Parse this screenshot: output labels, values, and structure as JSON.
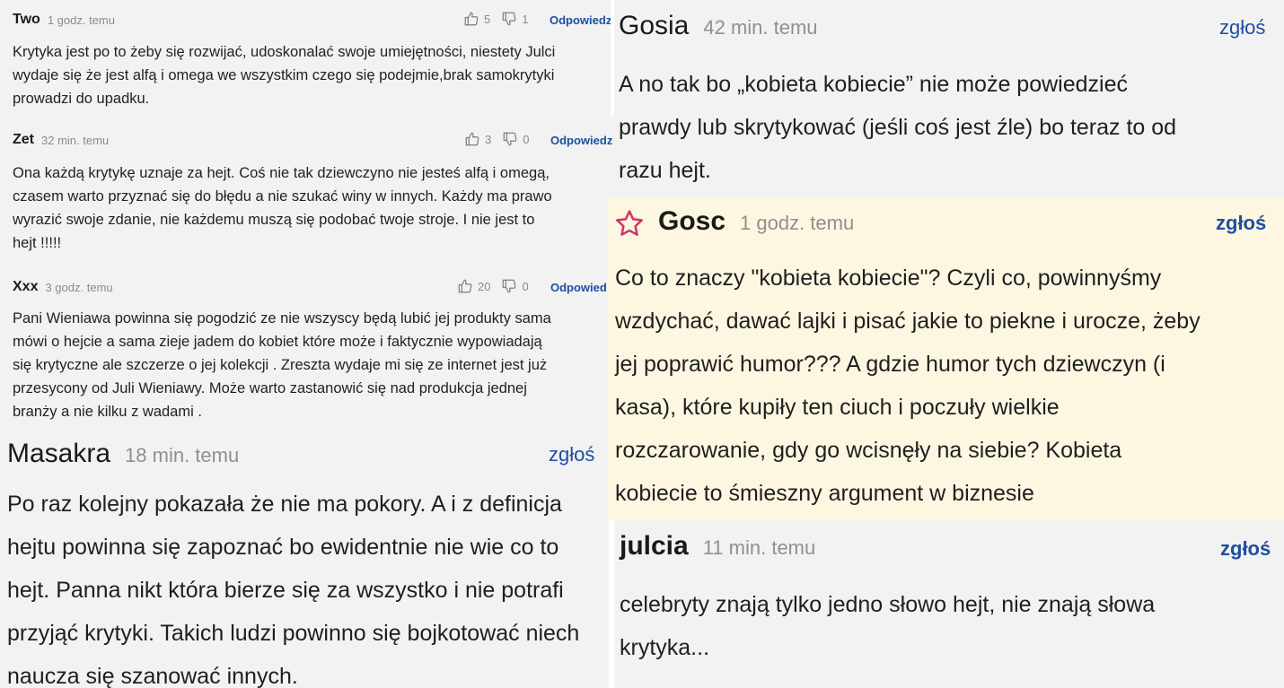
{
  "comments_small": [
    {
      "author": "Two",
      "time": "1 godz. temu",
      "likes": "5",
      "dislikes": "1",
      "reply_label": "Odpowiedz",
      "lines": [
        "Krytyka jest po to żeby się rozwijać, udoskonalać swoje umiejętności, niestety Julci",
        "wydaje się że jest alfą i omega we wszystkim czego się podejmie,brak samokrytyki",
        "prowadzi do upadku."
      ]
    },
    {
      "author": "Zet",
      "time": "32 min. temu",
      "likes": "3",
      "dislikes": "0",
      "reply_label": "Odpowiedz",
      "lines": [
        "Ona każdą krytykę uznaje za hejt. Coś nie tak dziewczyno nie jesteś alfą i omegą,",
        "czasem warto przyznać się do błędu a nie szukać winy w innych. Każdy ma prawo",
        "wyrazić swoje zdanie, nie każdemu muszą się podobać twoje stroje. I nie jest to",
        "hejt !!!!!"
      ]
    },
    {
      "author": "Xxx",
      "time": "3 godz. temu",
      "likes": "20",
      "dislikes": "0",
      "reply_label": "Odpowiedz",
      "lines": [
        "Pani Wieniawa powinna się pogodzić ze nie wszyscy będą lubić jej produkty sama",
        "mówi o hejcie a sama zieje jadem do kobiet które może i faktycznie wypowiadają",
        "się krytyczne ale szczerze o jej kolekcji . Zreszta wydaje mi się ze internet jest już",
        "przesycony od Juli Wieniawy. Może warto zastanowić się nad produkcja jednej",
        "branży a nie kilku z wadami ."
      ]
    }
  ],
  "comments_large": [
    {
      "author": "Masakra",
      "time": "18 min. temu",
      "report_label": "zgłoś",
      "lines": [
        "Po raz kolejny pokazała że nie ma pokory. A i z definicja",
        "hejtu powinna się zapoznać bo ewidentnie nie wie co to",
        "hejt. Panna nikt która bierze się za wszystko i nie potrafi",
        "przyjąć krytyki. Takich ludzi powinno się bojkotować niech",
        "naucza się szanować innych."
      ]
    },
    {
      "author": "Gosia",
      "time": "42 min. temu",
      "report_label": "zgłoś",
      "lines": [
        "A no tak bo „kobieta kobiecie” nie może powiedzieć",
        "prawdy lub skrytykować (jeśli coś jest źle) bo teraz to od",
        "razu hejt."
      ]
    },
    {
      "author": "Gosc",
      "time": "1 godz. temu",
      "report_label": "zgłoś",
      "featured": true,
      "lines": [
        "Co to znaczy \"kobieta kobiecie\"? Czyli co, powinnyśmy",
        "wzdychać, dawać lajki i pisać jakie to piekne i urocze, żeby",
        "jej poprawić humor??? A gdzie humor tych dziewczyn (i",
        "kasa), które kupiły ten ciuch i poczuły wielkie",
        "rozczarowanie, gdy go wcisnęły na siebie? Kobieta",
        "kobiecie to śmieszny argument w biznesie"
      ]
    },
    {
      "author": "julcia",
      "time": "11 min. temu",
      "report_label": "zgłoś",
      "lines": [
        "celebryty znają tylko jedno słowo hejt, nie znają słowa",
        "krytyka..."
      ]
    }
  ],
  "colors": {
    "panel_gray": "#f2f2f2",
    "featured_bg": "#fdf7e2",
    "link_blue": "#1e4ea3",
    "star_pink": "#d1356a",
    "muted_text": "#8a8a8a"
  },
  "icons": [
    "thumbs-up-icon",
    "thumbs-down-icon",
    "star-icon"
  ]
}
